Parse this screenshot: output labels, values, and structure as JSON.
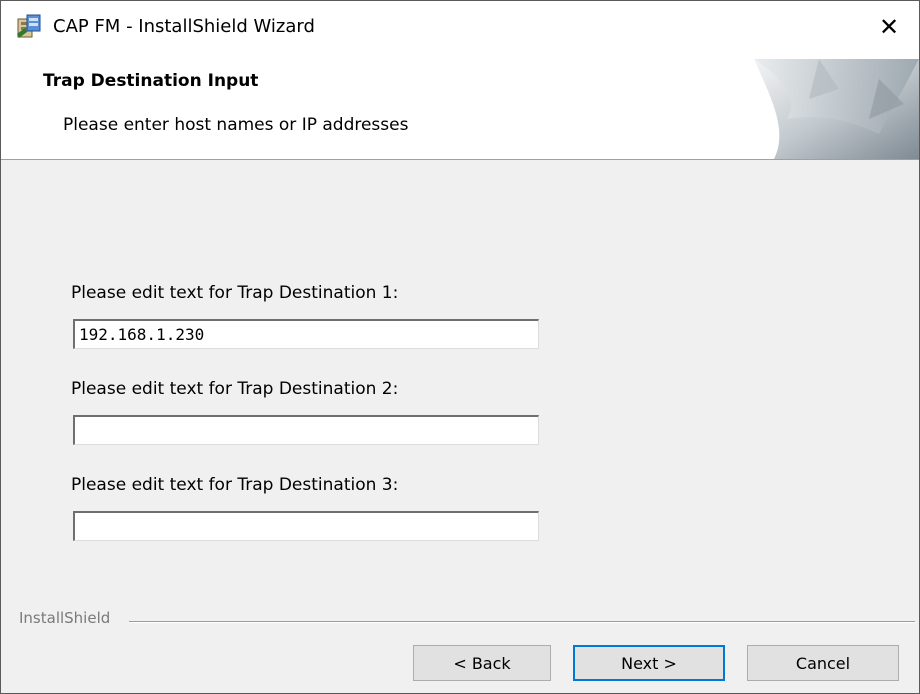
{
  "window": {
    "title": "CAP FM - InstallShield Wizard",
    "close_glyph": "✕"
  },
  "header": {
    "title": "Trap Destination Input",
    "subtitle": "Please enter host names or IP addresses"
  },
  "form": {
    "fields": [
      {
        "label": "Please edit text for Trap Destination 1:",
        "value": "192.168.1.230"
      },
      {
        "label": "Please edit text for Trap Destination 2:",
        "value": ""
      },
      {
        "label": "Please edit text for Trap Destination 3:",
        "value": ""
      }
    ]
  },
  "footer": {
    "brand": "InstallShield",
    "back_label": "< Back",
    "next_label": "Next >",
    "cancel_label": "Cancel"
  },
  "icons": {
    "app": "installer-icon",
    "close": "close-icon",
    "banner": "wizard-banner-graphic"
  },
  "colors": {
    "default_button_border": "#0078d7",
    "dialog_background": "#f0f0f0"
  }
}
